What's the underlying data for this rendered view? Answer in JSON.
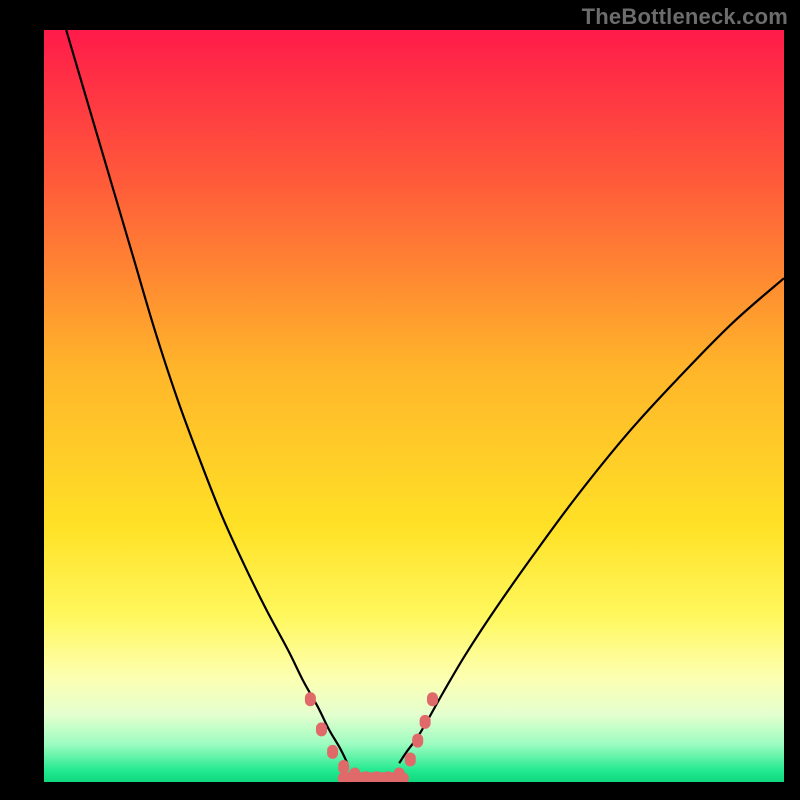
{
  "watermark": "TheBottleneck.com",
  "chart_data": {
    "type": "line",
    "title": "",
    "xlabel": "",
    "ylabel": "",
    "xlim": [
      0,
      100
    ],
    "ylim": [
      0,
      100
    ],
    "background_gradient": {
      "stops": [
        {
          "offset": 0.0,
          "color": "#ff1b4a"
        },
        {
          "offset": 0.2,
          "color": "#ff5a3a"
        },
        {
          "offset": 0.45,
          "color": "#ffb52a"
        },
        {
          "offset": 0.66,
          "color": "#ffe126"
        },
        {
          "offset": 0.78,
          "color": "#fff85e"
        },
        {
          "offset": 0.86,
          "color": "#fdffb0"
        },
        {
          "offset": 0.91,
          "color": "#e5ffcf"
        },
        {
          "offset": 0.95,
          "color": "#9cfcc0"
        },
        {
          "offset": 0.985,
          "color": "#22e98f"
        },
        {
          "offset": 1.0,
          "color": "#0fd87f"
        }
      ]
    },
    "series": [
      {
        "name": "left-curve",
        "stroke": "#000000",
        "x": [
          3,
          6,
          9,
          12,
          15,
          18,
          21,
          24,
          27,
          30,
          33,
          35,
          37,
          38.5,
          40,
          41
        ],
        "y": [
          100,
          90,
          80,
          70,
          60,
          51,
          43,
          35.5,
          29,
          23,
          17.5,
          13.5,
          10,
          7,
          4.5,
          2.5
        ]
      },
      {
        "name": "right-curve",
        "stroke": "#000000",
        "x": [
          48,
          49,
          50.5,
          52,
          54,
          57,
          61,
          66,
          72,
          79,
          86,
          93,
          100
        ],
        "y": [
          2.5,
          4,
          6,
          8.5,
          12,
          17,
          23,
          30,
          38,
          46.5,
          54,
          61,
          67
        ]
      },
      {
        "name": "marker-dots",
        "type": "scatter",
        "color": "#e06a6a",
        "x": [
          36,
          37.5,
          39,
          40.5,
          42,
          43.5,
          45,
          46.5,
          48,
          49.5,
          50.5,
          51.5,
          52.5
        ],
        "y": [
          11,
          7,
          4,
          2,
          1,
          0.5,
          0.5,
          0.5,
          1,
          3,
          5.5,
          8,
          11
        ]
      }
    ],
    "flat_segment": {
      "color": "#e06a6a",
      "x_start": 40.5,
      "x_end": 48.5,
      "y": 0.5
    }
  }
}
